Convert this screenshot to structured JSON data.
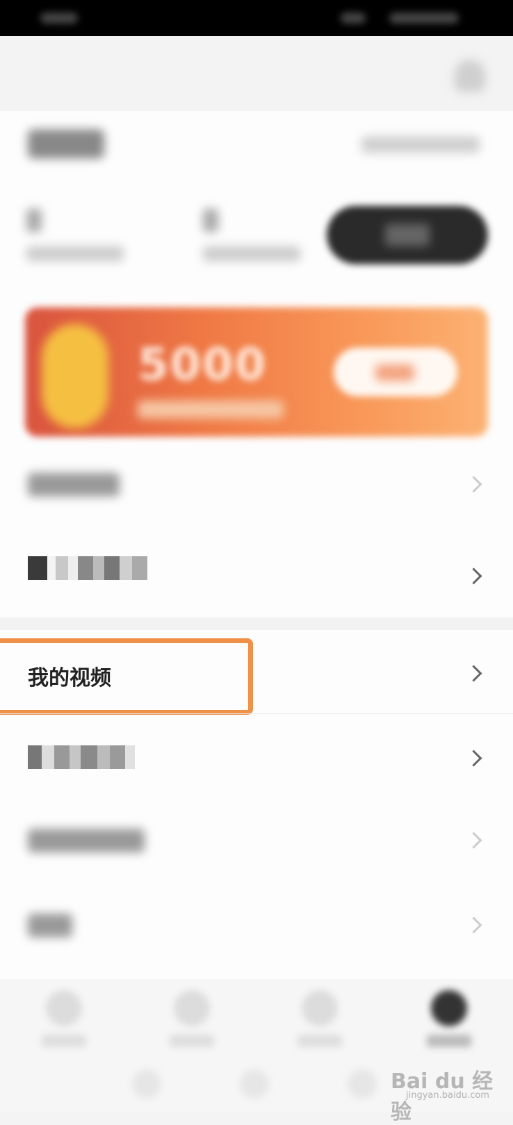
{
  "header": {
    "title": ""
  },
  "banner": {
    "amount": "5000"
  },
  "menu": {
    "my_videos": "我的视频"
  },
  "highlight_color": "#f0914a",
  "icons": {
    "bell": "bell-icon",
    "chevron": "chevron-right-icon"
  },
  "watermark": {
    "brand": "Bai du 经验",
    "url": "jingyan.baidu.com"
  }
}
